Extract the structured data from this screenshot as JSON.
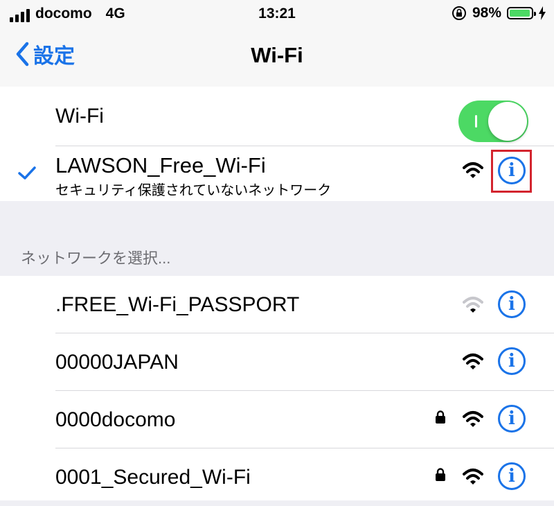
{
  "status_bar": {
    "carrier": "docomo",
    "network": "4G",
    "time": "13:21",
    "battery_percent": "98%",
    "battery_level": 0.98,
    "icons": [
      "signal-bars-icon",
      "orientation-lock-icon",
      "battery-icon",
      "charging-bolt-icon"
    ]
  },
  "nav": {
    "back_label": "設定",
    "title": "Wi-Fi"
  },
  "wifi_toggle": {
    "label": "Wi-Fi",
    "on": true
  },
  "connected": {
    "name": "LAWSON_Free_Wi-Fi",
    "subtitle": "セキュリティ保護されていないネットワーク",
    "secured": false,
    "highlighted_icon": "info-icon"
  },
  "section_header": "ネットワークを選択...",
  "networks": [
    {
      "name": ".FREE_Wi-Fi_PASSPORT",
      "secured": false,
      "signal": "weak"
    },
    {
      "name": "00000JAPAN",
      "secured": false,
      "signal": "full"
    },
    {
      "name": "0000docomo",
      "secured": true,
      "signal": "full"
    },
    {
      "name": "0001_Secured_Wi-Fi",
      "secured": true,
      "signal": "full"
    }
  ],
  "colors": {
    "accent": "#1a73e8",
    "toggle_on": "#4cd964",
    "highlight_box": "#d3242e",
    "background": "#efeff4"
  }
}
